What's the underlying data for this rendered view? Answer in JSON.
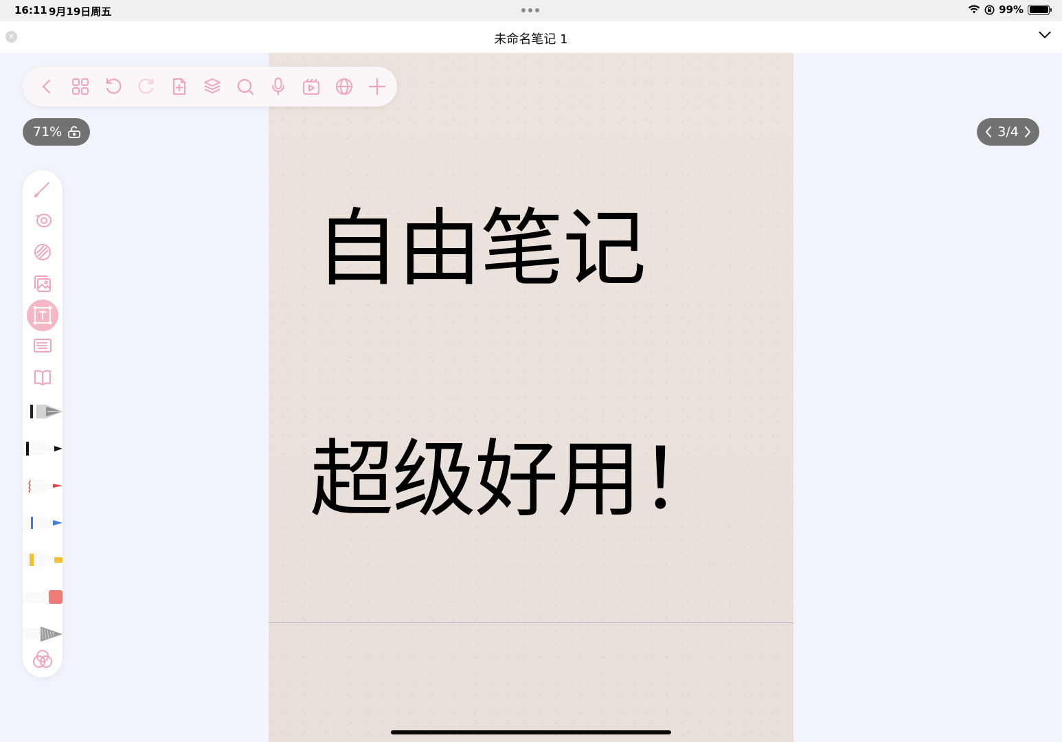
{
  "status_bar": {
    "time": "16:11",
    "date": "9月19日周五",
    "battery_percent": "99%",
    "battery_level": 0.99
  },
  "title_bar": {
    "title": "未命名笔记 1"
  },
  "toolbar": {
    "icons": [
      "back-icon",
      "grid-icon",
      "undo-icon",
      "redo-icon",
      "add-page-icon",
      "layers-icon",
      "search-icon",
      "microphone-icon",
      "media-icon",
      "globe-icon",
      "plus-icon"
    ]
  },
  "zoom": {
    "label": "71%"
  },
  "pager": {
    "label": "3/4"
  },
  "canvas": {
    "line1": "自由笔记",
    "line2": "超级好用！"
  },
  "sidebar": {
    "tools": [
      "pencil-icon",
      "lasso-icon",
      "shape-icon",
      "image-icon",
      "textbox-icon",
      "keyboard-icon",
      "book-icon"
    ],
    "active_tool": "textbox-icon",
    "pens": [
      {
        "name": "fountain-pen",
        "color": "#222222"
      },
      {
        "name": "ballpoint-pen",
        "color": "#111111"
      },
      {
        "name": "brush-pen",
        "color": "#e0463e"
      },
      {
        "name": "pen",
        "color": "#3a7de6"
      },
      {
        "name": "highlighter",
        "color": "#f2c230"
      },
      {
        "name": "eraser",
        "color": "#ec7c78"
      },
      {
        "name": "pencil",
        "color": "#9a9a9a"
      }
    ]
  },
  "colors": {
    "accent": "#f5a8bd",
    "pill": "#727272",
    "paper": "#e9e1da"
  }
}
